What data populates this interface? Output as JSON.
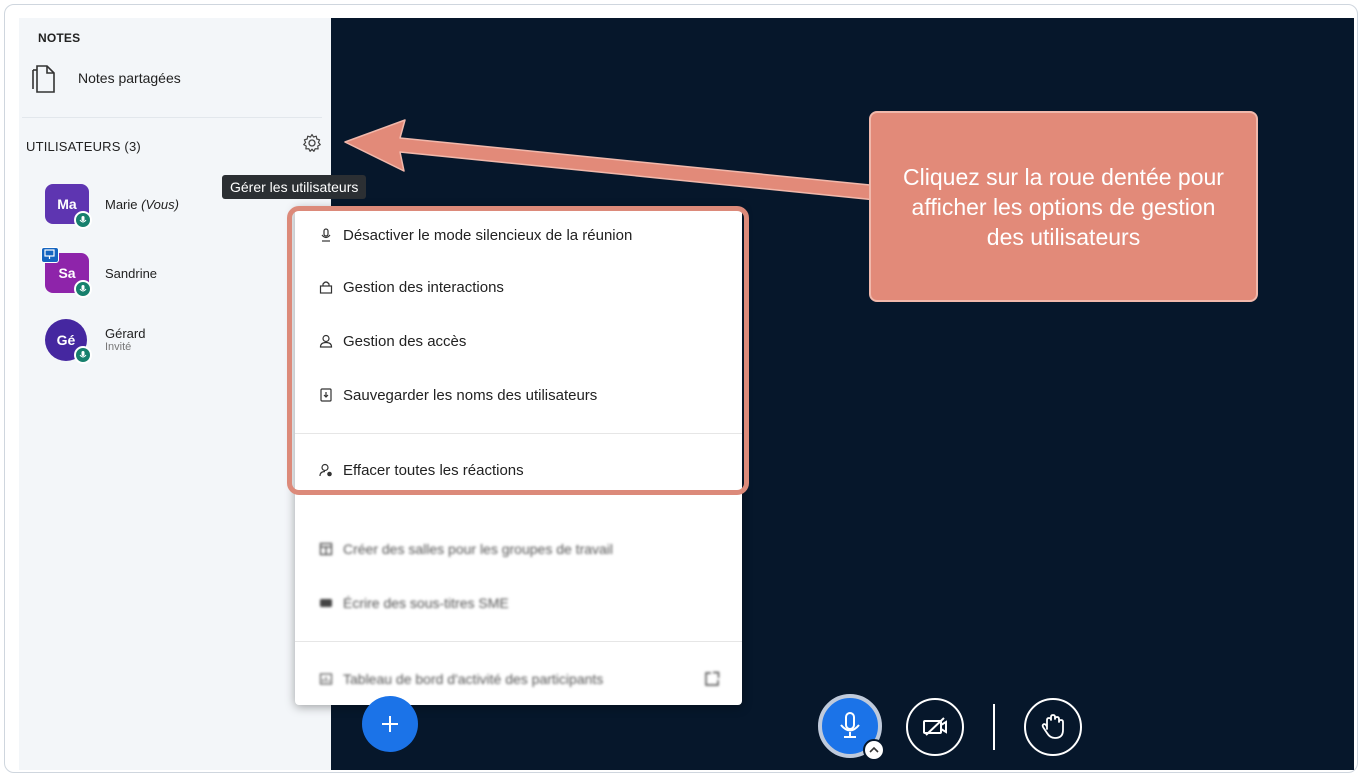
{
  "sidebar": {
    "notes_title": "NOTES",
    "notes_item": "Notes partagées",
    "users_title": "UTILISATEURS (3)",
    "users": [
      {
        "initials": "Ma",
        "name": "Marie",
        "suffix": "(Vous)",
        "role": "",
        "color": "#5e35b1"
      },
      {
        "initials": "Sa",
        "name": "Sandrine",
        "suffix": "",
        "role": "",
        "color": "#8e24aa"
      },
      {
        "initials": "Gé",
        "name": "Gérard",
        "suffix": "",
        "role": "Invité",
        "color": "#4527a0"
      }
    ]
  },
  "tooltip": "Gérer les utilisateurs",
  "menu": {
    "items": [
      {
        "label": "Désactiver le mode silencieux de la réunion",
        "icon": "mic-icon"
      },
      {
        "label": "Gestion des interactions",
        "icon": "lock-icon"
      },
      {
        "label": "Gestion des accès",
        "icon": "user-icon"
      },
      {
        "label": "Sauvegarder les noms des utilisateurs",
        "icon": "download-file-icon"
      },
      {
        "label": "Effacer toutes les réactions",
        "icon": "user-clear-icon"
      },
      {
        "label": "Créer des salles pour les groupes de travail",
        "icon": "rooms-icon"
      },
      {
        "label": "Écrire des sous-titres SME",
        "icon": "captions-icon"
      },
      {
        "label": "Tableau de bord d'activité des participants",
        "icon": "dashboard-icon"
      }
    ]
  },
  "callout": {
    "text": "Cliquez sur la roue dentée pour afficher les options de gestion des utilisateurs",
    "color": "#e28a79"
  },
  "colors": {
    "accent": "#1b73e8",
    "main_bg": "#06172b",
    "sidebar_bg": "#f3f6f9",
    "talking": "#17806d"
  }
}
